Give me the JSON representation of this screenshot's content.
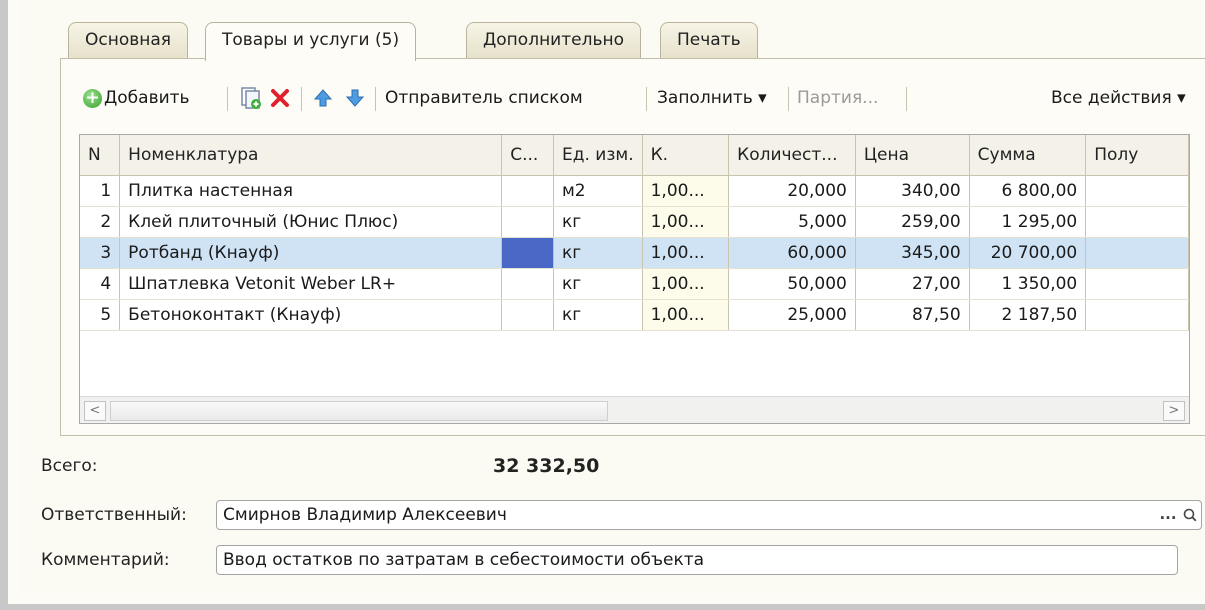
{
  "tabs": [
    {
      "label": "Основная"
    },
    {
      "label": "Товары и услуги (5)"
    },
    {
      "label": "Дополнительно"
    },
    {
      "label": "Печать"
    }
  ],
  "toolbar": {
    "add_label": "Добавить",
    "send_list_label": "Отправитель списком",
    "fill_label": "Заполнить ▾",
    "batch_label": "Партия...",
    "all_actions_label": "Все действия ▾"
  },
  "table": {
    "columns": [
      "N",
      "Номенклатура",
      "С...",
      "Ед. изм.",
      "К.",
      "Количест...",
      "Цена",
      "Сумма",
      "Полу"
    ],
    "rows": [
      {
        "n": "1",
        "name": "Плитка настенная",
        "c": "",
        "unit": "м2",
        "k": "1,00...",
        "qty": "20,000",
        "price": "340,00",
        "sum": "6 800,00",
        "extra": ""
      },
      {
        "n": "2",
        "name": "Клей плиточный (Юнис Плюс)",
        "c": "",
        "unit": "кг",
        "k": "1,00...",
        "qty": "5,000",
        "price": "259,00",
        "sum": "1 295,00",
        "extra": ""
      },
      {
        "n": "3",
        "name": "Ротбанд (Кнауф)",
        "c": "",
        "unit": "кг",
        "k": "1,00...",
        "qty": "60,000",
        "price": "345,00",
        "sum": "20 700,00",
        "extra": ""
      },
      {
        "n": "4",
        "name": "Шпатлевка Vetonit Weber LR+",
        "c": "",
        "unit": "кг",
        "k": "1,00...",
        "qty": "50,000",
        "price": "27,00",
        "sum": "1 350,00",
        "extra": ""
      },
      {
        "n": "5",
        "name": "Бетоноконтакт (Кнауф)",
        "c": "",
        "unit": "кг",
        "k": "1,00...",
        "qty": "25,000",
        "price": "87,50",
        "sum": "2 187,50",
        "extra": ""
      }
    ]
  },
  "totals": {
    "label": "Всего:",
    "value": "32 332,50"
  },
  "responsible": {
    "label": "Ответственный:",
    "value": "Смирнов Владимир Алексеевич"
  },
  "comment": {
    "label": "Комментарий:",
    "value": "Ввод остатков по затратам в себестоимости объекта"
  },
  "colors": {
    "selected_row": "#cfe3f5",
    "selected_cell": "#4a69c6",
    "delete_icon": "#e0202a",
    "add_icon": "#35a02b"
  },
  "icons": [
    "add-icon",
    "copy-icon",
    "delete-icon",
    "move-up-icon",
    "move-down-icon",
    "select-icon",
    "search-icon"
  ]
}
